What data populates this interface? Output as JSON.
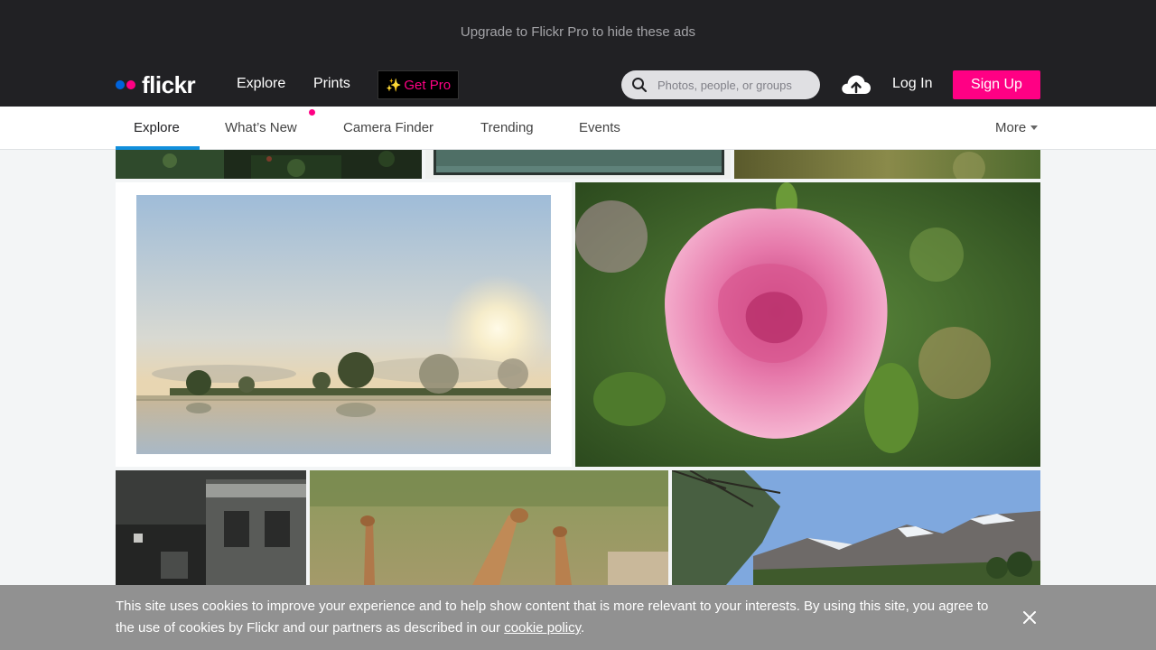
{
  "ad_banner": {
    "text": "Upgrade to Flickr Pro to hide these ads"
  },
  "header": {
    "logo_text": "flickr",
    "nav": [
      {
        "label": "Explore"
      },
      {
        "label": "Prints"
      }
    ],
    "get_pro_label": "Get Pro",
    "search": {
      "placeholder": "Photos, people, or groups",
      "value": ""
    },
    "login_label": "Log In",
    "signup_label": "Sign Up"
  },
  "subnav": {
    "tabs": [
      {
        "label": "Explore",
        "active": true
      },
      {
        "label": "What’s New",
        "active": false
      },
      {
        "label": "Camera Finder",
        "active": false
      },
      {
        "label": "Trending",
        "active": false
      },
      {
        "label": "Events",
        "active": false
      }
    ],
    "more_label": "More"
  },
  "photos": [
    {
      "subject": "garden-foliage"
    },
    {
      "subject": "framed-teal-print"
    },
    {
      "subject": "blurred-green-nature"
    },
    {
      "subject": "misty-lake-sunrise"
    },
    {
      "subject": "pink-rose"
    },
    {
      "subject": "old-building-bw"
    },
    {
      "subject": "giraffes-grassland"
    },
    {
      "subject": "mountain-valley-trees"
    }
  ],
  "cookie_banner": {
    "text": "This site uses cookies to improve your experience and to help show content that is more relevant to your interests. By using this site, you agree to the use of cookies by Flickr and our partners as described in our ",
    "link_text": "cookie policy",
    "suffix": "."
  },
  "colors": {
    "brand_pink": "#ff0084",
    "brand_blue": "#0063dc",
    "active_tab": "#128fdc",
    "header_bg": "#212124"
  }
}
